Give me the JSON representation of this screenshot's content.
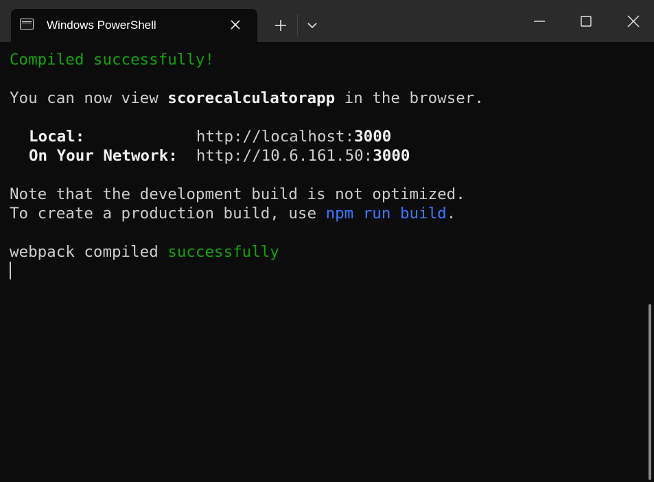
{
  "window": {
    "tab_title": "Windows PowerShell",
    "icons": {
      "tab_icon": "terminal-icon",
      "tab_close": "close-icon",
      "new_tab": "plus-icon",
      "dropdown": "chevron-down-icon",
      "minimize": "minimize-icon",
      "maximize": "maximize-icon",
      "close": "close-icon"
    }
  },
  "terminal": {
    "line1": "Compiled successfully!",
    "line2_pre": "You can now view ",
    "line2_app": "scorecalculatorapp",
    "line2_post": " in the browser.",
    "local_label": "Local:",
    "local_url_pre": "http://localhost:",
    "local_port": "3000",
    "network_label": "On Your Network:",
    "network_url_pre": "http://10.6.161.50:",
    "network_port": "3000",
    "note_line": "Note that the development build is not optimized.",
    "prod_pre": "To create a production build, use ",
    "prod_cmd": "npm run build",
    "prod_post": ".",
    "webpack_pre": "webpack compiled ",
    "webpack_status": "successfully"
  },
  "colors": {
    "background": "#0c0c0c",
    "titlebar": "#2b2b2b",
    "text": "#cccccc",
    "success_green": "#13a10e",
    "command_blue": "#3b78ff"
  }
}
